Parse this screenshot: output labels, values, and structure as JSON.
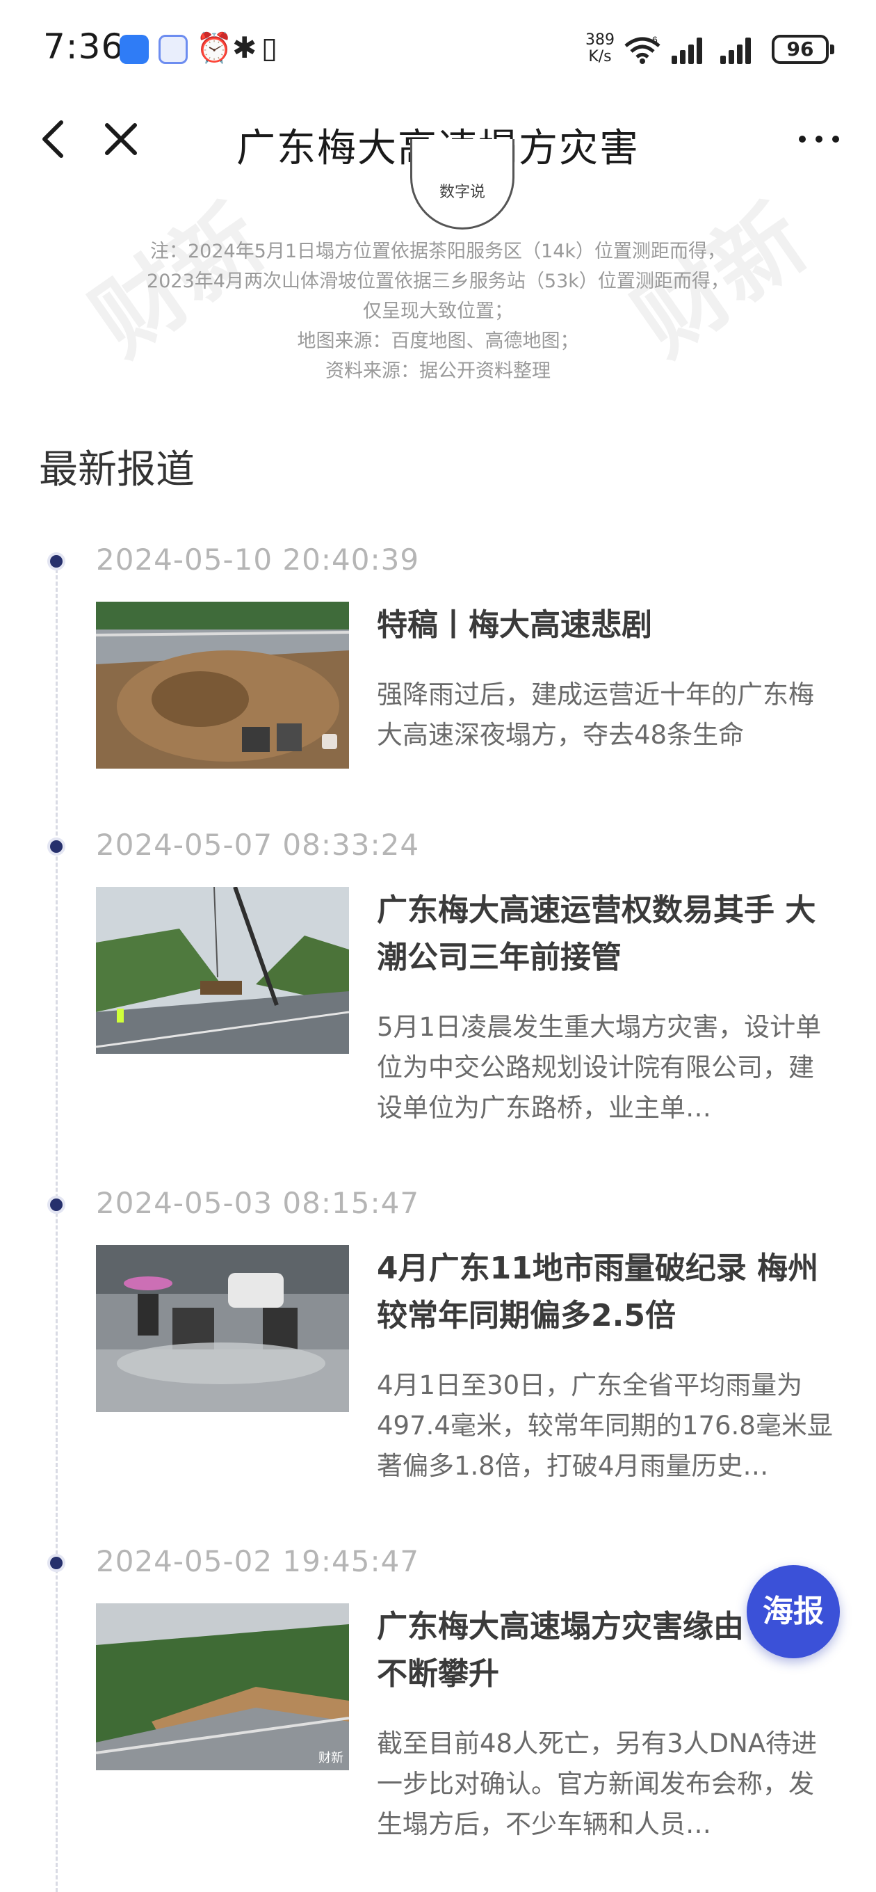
{
  "status_bar": {
    "time": "7:36",
    "net_speed_value": "389",
    "net_speed_unit": "K/s",
    "wifi_label": "6",
    "battery": "96"
  },
  "nav": {
    "title": "广东梅大高速塌方灾害",
    "back_icon": "back-arrow-icon",
    "close_icon": "close-icon",
    "more_icon": "more-icon"
  },
  "map_notes": {
    "logo_text": "数字说",
    "lines": [
      "注：2024年5月1日塌方位置依据茶阳服务区（14k）位置测距而得，",
      "2023年4月两次山体滑坡位置依据三乡服务站（53k）位置测距而得，",
      "仅呈现大致位置；",
      "地图来源：百度地图、高德地图；",
      "资料来源：据公开资料整理"
    ]
  },
  "section": {
    "title": "最新报道"
  },
  "articles": [
    {
      "date": "2024-05-10 20:40:39",
      "headline": "特稿丨梅大高速悲剧",
      "summary": "强降雨过后，建成运营近十年的广东梅大高速深夜塌方，夺去48条生命"
    },
    {
      "date": "2024-05-07 08:33:24",
      "headline": "广东梅大高速运营权数易其手 大潮公司三年前接管",
      "summary": "5月1日凌晨发生重大塌方灾害，设计单位为中交公路规划设计院有限公司，建设单位为广东路桥，业主单…"
    },
    {
      "date": "2024-05-03 08:15:47",
      "headline": "4月广东11地市雨量破纪录 梅州较常年同期偏多2.5倍",
      "summary": "4月1日至30日，广东全省平均雨量为497.4毫米，较常年同期的176.8毫米显著偏多1.8倍，打破4月雨量历史…"
    },
    {
      "date": "2024-05-02 19:45:47",
      "headline": "广东梅大高速塌方灾害缘由 人数不断攀升",
      "summary": "截至目前48人死亡，另有3人DNA待进一步比对确认。官方新闻发布会称，发生塌方后，不少车辆和人员…"
    }
  ],
  "fab": {
    "label": "海报"
  },
  "thumb4_watermark": "财新"
}
